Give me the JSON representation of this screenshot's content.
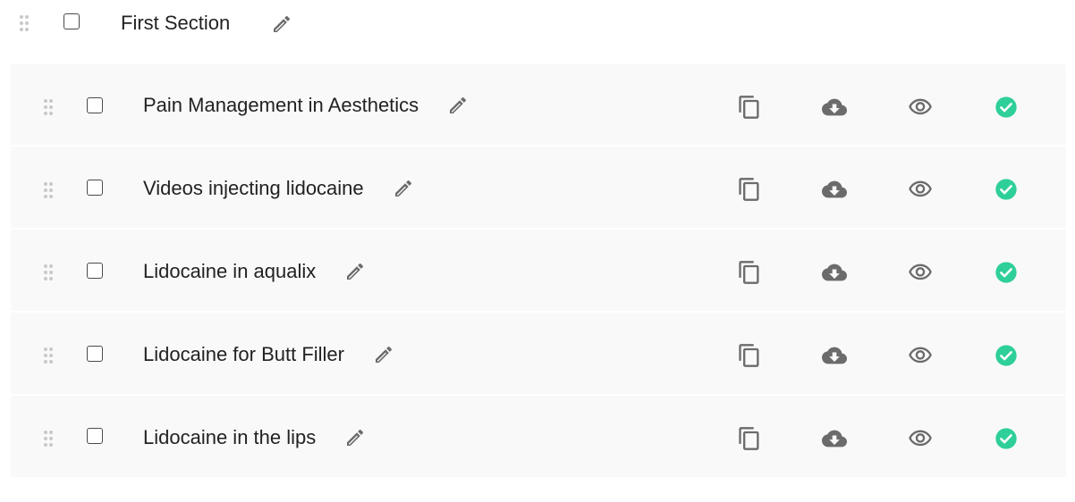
{
  "section": {
    "title": "First Section"
  },
  "lessons": [
    {
      "title": "Pain Management in Aesthetics",
      "status": "published"
    },
    {
      "title": "Videos injecting lidocaine",
      "status": "published"
    },
    {
      "title": "Lidocaine in aqualix",
      "status": "published"
    },
    {
      "title": "Lidocaine for Butt Filler",
      "status": "published"
    },
    {
      "title": "Lidocaine in the lips",
      "status": "published"
    }
  ],
  "icons": {
    "drag": "drag-handle-icon",
    "edit": "pencil-icon",
    "duplicate": "copy-icon",
    "download": "cloud-download-icon",
    "preview": "eye-icon",
    "status": "check-circle-icon"
  },
  "colors": {
    "status_check": "#2fcf9a",
    "icon_gray": "#6b6b6b",
    "row_background": "#f9f9f9"
  }
}
